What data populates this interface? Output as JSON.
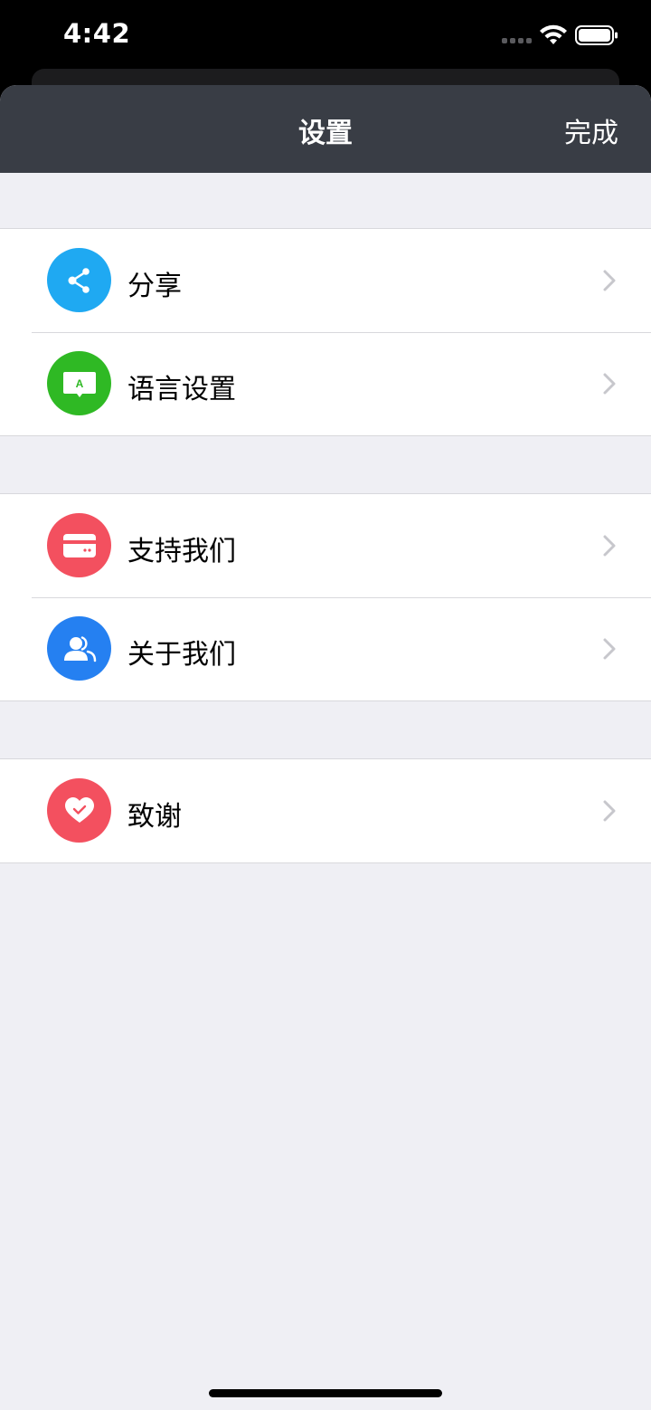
{
  "status_bar": {
    "time": "4:42"
  },
  "nav": {
    "title": "设置",
    "done_label": "完成"
  },
  "groups": [
    {
      "items": [
        {
          "label": "分享",
          "icon": "share-icon",
          "color": "#1fa9f2"
        },
        {
          "label": "语言设置",
          "icon": "language-icon",
          "color": "#2fb924"
        }
      ]
    },
    {
      "items": [
        {
          "label": "支持我们",
          "icon": "credit-card-icon",
          "color": "#f3505f"
        },
        {
          "label": "关于我们",
          "icon": "people-icon",
          "color": "#2580f1"
        }
      ]
    },
    {
      "items": [
        {
          "label": "致谢",
          "icon": "heart-icon",
          "color": "#f3505f"
        }
      ]
    }
  ],
  "colors": {
    "nav_background": "#393d45",
    "page_background": "#efeff4",
    "chevron": "#c7c7cc"
  }
}
